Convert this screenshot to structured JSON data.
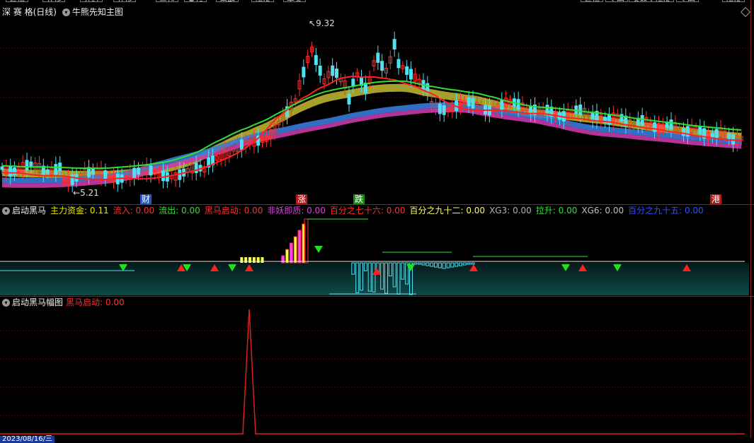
{
  "top_toolbar": [
    "复权",
    "分析",
    "分时",
    "分析",
    "画线",
    "叠加",
    "周期",
    "切换",
    "更多",
    "复权",
    "主图",
    "多股",
    "切换",
    "主图",
    "切换"
  ],
  "main": {
    "stock_name": "深 赛 格(日线)",
    "indicator": "牛熊先知主图",
    "high_label": "9.32",
    "low_label": "5.21",
    "tags": [
      {
        "text": "财",
        "color": "#3a6fd8"
      },
      {
        "text": "涨",
        "color": "#c81e1e"
      },
      {
        "text": "跌",
        "color": "#1ea01e"
      },
      {
        "text": "港",
        "color": "#c81e1e"
      }
    ]
  },
  "panel2": {
    "title": "启动黑马",
    "values": [
      {
        "label": "主力资金:",
        "value": "0.11",
        "color": "#e6e600"
      },
      {
        "label": "流入:",
        "value": "0.00",
        "color": "#ff3030"
      },
      {
        "label": "流出:",
        "value": "0.00",
        "color": "#30e030"
      },
      {
        "label": "黑马启动:",
        "value": "0.00",
        "color": "#ff3030"
      },
      {
        "label": "非妖即质:",
        "value": "0.00",
        "color": "#e040e0"
      },
      {
        "label": "百分之七十六:",
        "value": "0.00",
        "color": "#ff3030"
      },
      {
        "label": "百分之九十二:",
        "value": "0.00",
        "color": "#ffff60"
      },
      {
        "label": "XG3:",
        "value": "0.00",
        "color": "#b0b0b0"
      },
      {
        "label": "拉升:",
        "value": "0.00",
        "color": "#30e030"
      },
      {
        "label": "XG6:",
        "value": "0.00",
        "color": "#c0c0c0"
      },
      {
        "label": "百分之九十五:",
        "value": "0.00",
        "color": "#3050ff"
      }
    ]
  },
  "panel3": {
    "title": "启动黑马幅图",
    "value_label": "黑马启动:",
    "value": "0.00"
  },
  "bottom": {
    "date": "2023/08/16/三"
  }
}
